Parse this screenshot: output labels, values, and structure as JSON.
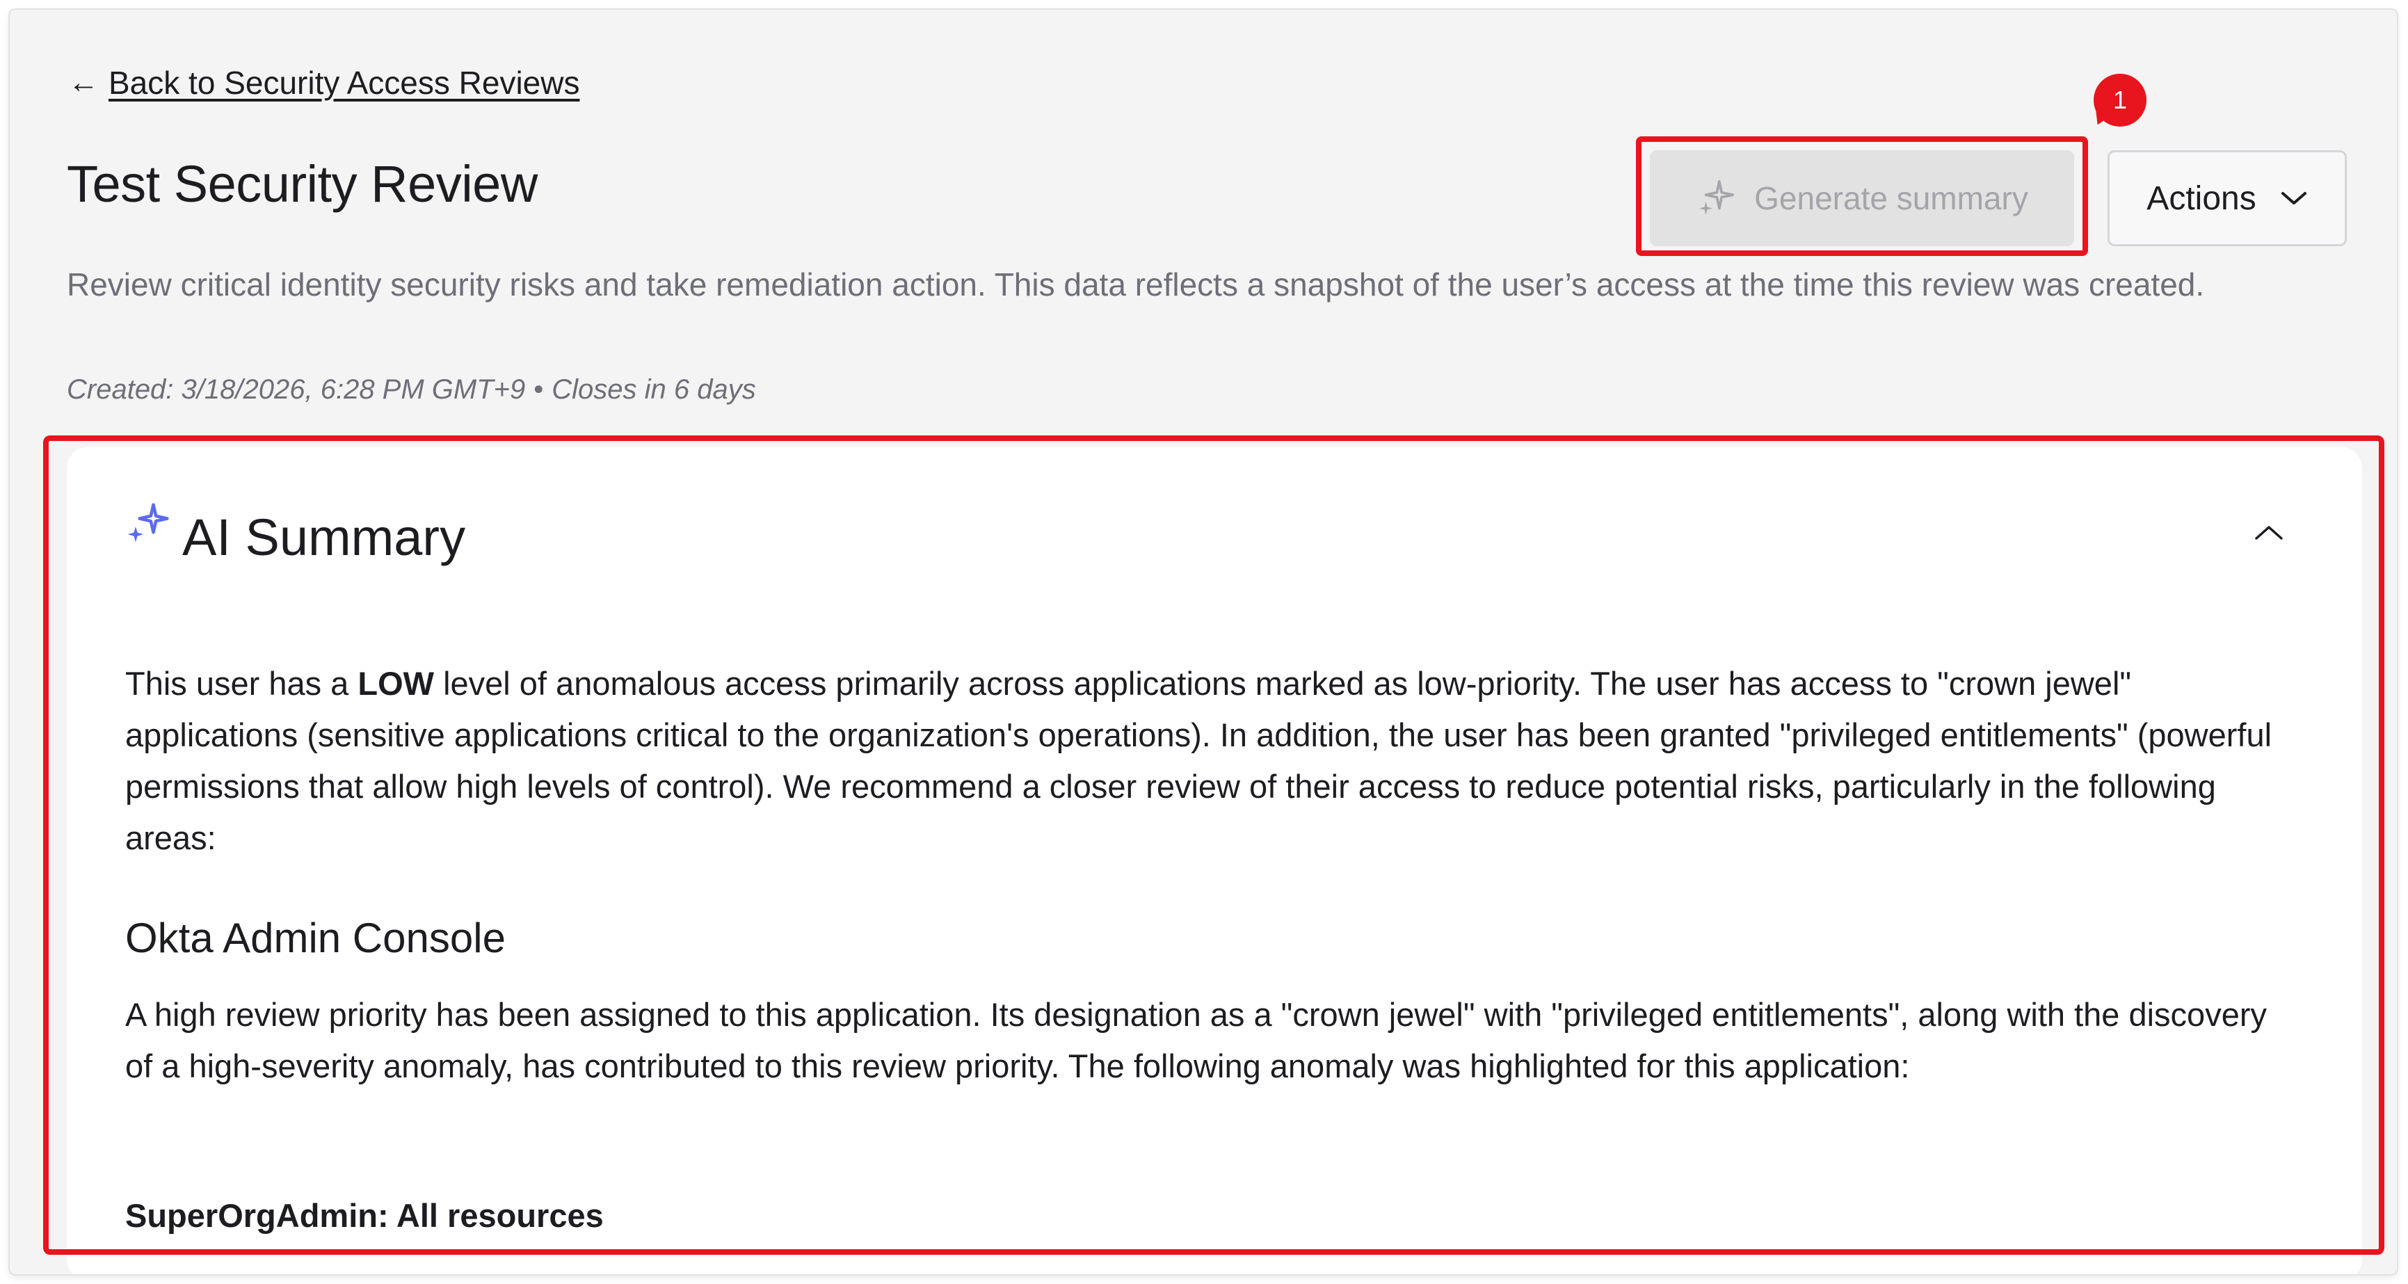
{
  "header": {
    "back_label": "Back to Security Access Reviews",
    "title": "Test Security Review",
    "description": "Review critical identity security risks and take remediation action. This data reflects a snapshot of the user’s access at the time this review was created.",
    "created": "Created: 3/18/2026, 6:28 PM GMT+9",
    "meta_separator": "•",
    "closes": "Closes in 6 days"
  },
  "toolbar": {
    "generate_label": "Generate summary",
    "generate_disabled": true,
    "actions_label": "Actions"
  },
  "annotation": {
    "badge_number": "1"
  },
  "summary": {
    "title": "AI Summary",
    "intro_before": "This user has a ",
    "intro_level": "LOW",
    "intro_after": " level of anomalous access primarily across applications marked as low-priority. The user has access to \"crown jewel\" applications (sensitive applications critical to the organization's operations). In addition, the user has been granted \"privileged entitlements\" (powerful permissions that allow high levels of control). We recommend a closer review of their access to reduce potential risks, particularly in the following areas:",
    "app_name": "Okta Admin Console",
    "app_description": "A high review priority has been assigned to this application. Its designation as a \"crown jewel\" with \"privileged entitlements\", along with the discovery of a high-severity anomaly, has contributed to this review priority. The following anomaly was highlighted for this application:",
    "anomaly_title": "SuperOrgAdmin: All resources"
  },
  "icons": {
    "back": "arrow-left-icon",
    "generate": "sparkle-icon",
    "actions": "chevron-down-icon",
    "summary": "sparkle-icon",
    "collapse": "chevron-up-icon"
  },
  "colors": {
    "highlight": "#e8141e",
    "sparkle_blue": "#5b6cf0",
    "disabled_text": "#a4a4aa"
  }
}
